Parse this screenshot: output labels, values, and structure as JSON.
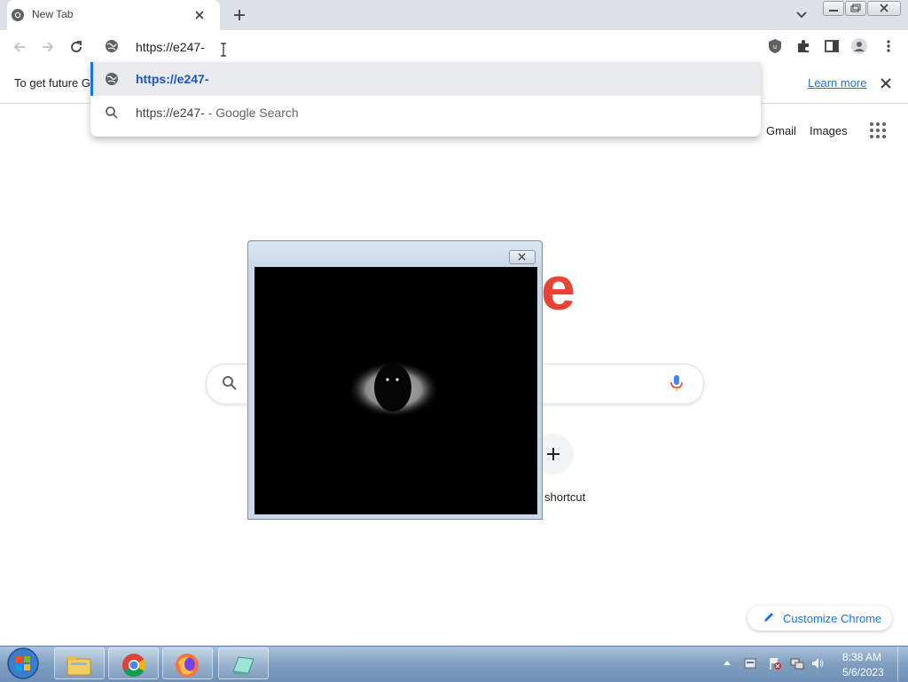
{
  "browser": {
    "tab": {
      "title": "New Tab",
      "favicon": "chrome-icon"
    },
    "omnibox": {
      "value": "https://e247-"
    },
    "suggestions": [
      {
        "icon": "globe-icon",
        "text": "https://e247-"
      },
      {
        "icon": "search-icon",
        "text": "https://e247-",
        "suffix": " - Google Search"
      }
    ],
    "infobar": {
      "text": "To get future G",
      "link": "Learn more"
    }
  },
  "ntp": {
    "gmail": "Gmail",
    "images": "Images",
    "logo_fragment": "e",
    "shortcut_label": "shortcut",
    "customize": "Customize Chrome"
  },
  "popup": {
    "content": "eye-image"
  },
  "taskbar": {
    "apps": [
      "explorer-icon",
      "chrome-icon",
      "firefox-icon",
      "app-icon"
    ],
    "clock_time": "8:38 AM",
    "clock_date": "5/6/2023"
  },
  "colors": {
    "accent": "#1a73e8",
    "google_red": "#ea4335",
    "tabstrip": "#dee1e6"
  }
}
